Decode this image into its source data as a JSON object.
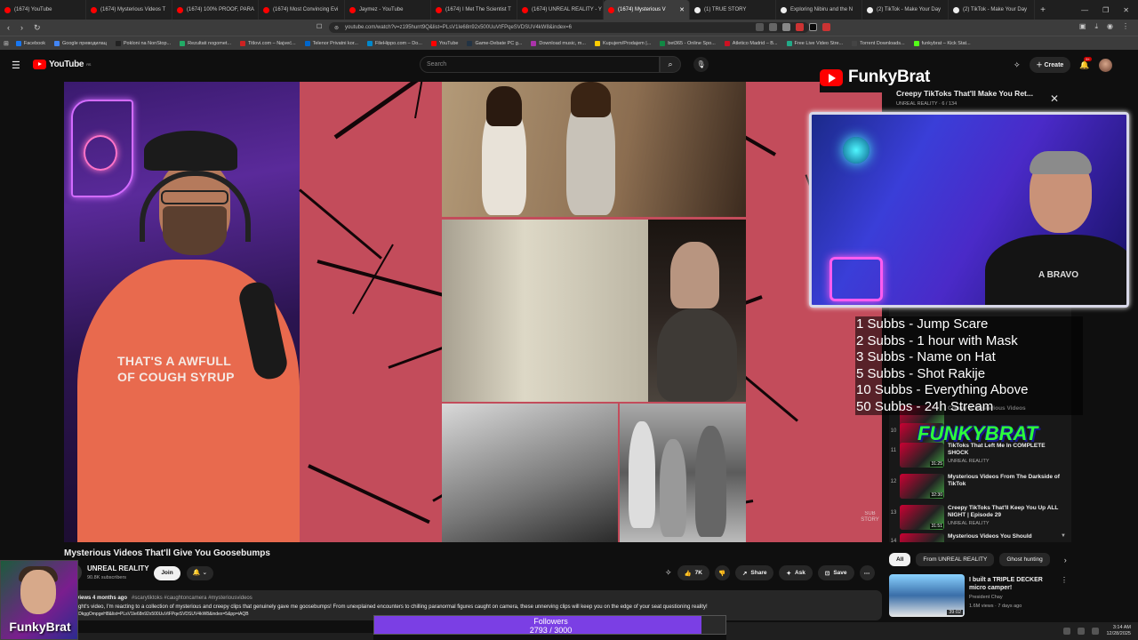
{
  "browser": {
    "tabs": [
      {
        "label": "(1674) YouTube",
        "active": false
      },
      {
        "label": "(1674) Mysterious Videos T",
        "active": false
      },
      {
        "label": "(1674) 100% PROOF, PARA",
        "active": false
      },
      {
        "label": "(1674) Most Convincing Evi",
        "active": false
      },
      {
        "label": "Jaymez - YouTube",
        "active": false
      },
      {
        "label": "(1674) I Met The Scientist T",
        "active": false
      },
      {
        "label": "(1674) UNREAL REALITY - Y",
        "active": false
      },
      {
        "label": "(1674) Mysterious V",
        "active": true
      },
      {
        "label": "(1) TRUE STORY",
        "active": false
      },
      {
        "label": "Exploring Nibiru and the N",
        "active": false
      },
      {
        "label": "(2) TikTok - Make Your Day",
        "active": false
      },
      {
        "label": "(2) TikTok - Make Your Day",
        "active": false
      }
    ],
    "new_tab": "+",
    "url": "youtube.com/watch?v=z195hurrt9Q&list=PLsV1Ie68n92x500UuVtFPqeSVDSUV4kW8&index=6",
    "bookmarks": [
      "Facebook",
      "Google преводилац",
      "Pokloni na NonStop...",
      "Rezultati nogomet...",
      "Titlovi.com – Najveć...",
      "Telenor Privatni kor...",
      "FileHippo.com – Do...",
      "YouTube",
      "Game-Debate PC g...",
      "Download music, m...",
      "Kupujem/Prodajem |...",
      "bet365 - Online Spo...",
      "Atletico Madrid – B...",
      "Free Live Video Stre...",
      "Torrent Downloads...",
      "funkybrat – Kick Stat..."
    ]
  },
  "youtube": {
    "logo_text": "YouTube",
    "logo_region": "RS",
    "search_placeholder": "Search",
    "create_label": "Create",
    "notification_count": "9+"
  },
  "overlay": {
    "brand_name": "FunkyBrat",
    "playlist_title": "Creepy TikToks That'll Make You Ret...",
    "playlist_sub": "UNREAL REALITY · 6 / 134",
    "webcam_shirt_text": "A BRAVO",
    "goals": [
      "1 Subbs - Jump Scare",
      "2 Subbs - 1 hour with Mask",
      "3 Subbs - Name on Hat",
      "5 Subbs - Shot Rakije",
      "10 Subbs - Everything Above",
      "50 Subbs - 24h Stream"
    ],
    "corner_name": "FunkyBrat",
    "followers_label": "Followers",
    "followers_current": 2793,
    "followers_goal": 3000,
    "followers_text": "2793 / 3000"
  },
  "video": {
    "shirt_text_line1": "THAT'S A AWFULL",
    "shirt_text_line2": "OF COUGH SYRUP",
    "title": "Mysterious Videos That'll Give You Goosebumps",
    "channel": "UNREAL REALITY",
    "subscribers": "90.8K subscribers",
    "join_label": "Join",
    "likes": "7K",
    "share_label": "Share",
    "ask_label": "Ask",
    "save_label": "Save",
    "desc_meta": "K views  4 months ago",
    "desc_tags": "#scarytiktoks #caughtoncamera #mysteriousvideos",
    "desc_text": "onight's video, I'm reacting to a collection of mysterious and creepy clips that genuinely gave me goosebumps! From unexplained encounters to chilling paranormal figures caught on camera, these unnerving clips will keep you on the edge of your seat questioning reality!",
    "desc_link": "?v=DkggOmpgeH8&list=PLsV1Ie68n92x500UuVtFPqeSVDSUV4kW8&index=5&pp=iAQB",
    "substory": "SUB STORY"
  },
  "playlist": {
    "items": [
      {
        "num": "",
        "title": "Creepy & Mysterious Videos",
        "channel": "",
        "duration": ""
      },
      {
        "num": "10",
        "title": "",
        "channel": "",
        "duration": ""
      },
      {
        "num": "11",
        "title": "TikToks That Left Me In COMPLETE SHOCK",
        "channel": "UNREAL REALITY",
        "duration": "31:25"
      },
      {
        "num": "12",
        "title": "Mysterious Videos From The Darkside of TikTok",
        "channel": "",
        "duration": "32:30"
      },
      {
        "num": "13",
        "title": "Creepy TikToks That'll Keep You Up ALL NIGHT | Episode 29",
        "channel": "UNREAL REALITY",
        "duration": "31:51"
      },
      {
        "num": "14",
        "title": "Mysterious Videos You Should",
        "channel": "",
        "duration": ""
      }
    ]
  },
  "chips": [
    "All",
    "From UNREAL REALITY",
    "Ghost hunting"
  ],
  "recommendation": {
    "title": "I built a TRIPLE DECKER micro camper!",
    "channel": "President Chay",
    "views": "1.6M views · 7 days ago",
    "duration": "39:02"
  },
  "taskbar": {
    "time": "3:14 AM",
    "date": "12/28/2025"
  }
}
